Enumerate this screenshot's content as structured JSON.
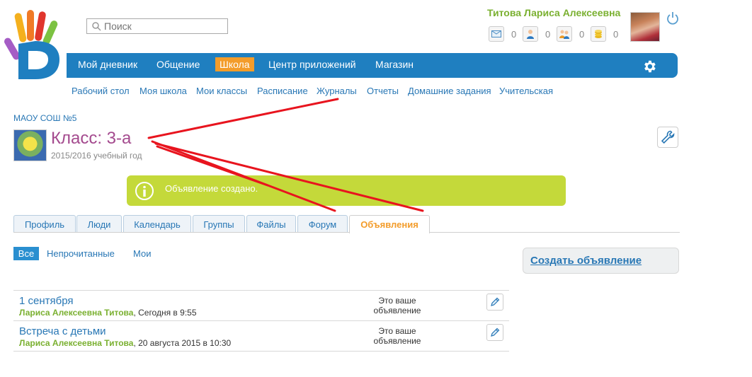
{
  "search": {
    "placeholder": "Поиск"
  },
  "user": {
    "name": "Титова Лариса Алексеевна",
    "counters": [
      {
        "icon": "mail-icon",
        "count": "0"
      },
      {
        "icon": "person-icon",
        "count": "0"
      },
      {
        "icon": "people-icon",
        "count": "0"
      },
      {
        "icon": "coins-icon",
        "count": "0"
      }
    ]
  },
  "nav": {
    "items": [
      "Мой дневник",
      "Общение",
      "Школа",
      "Центр приложений",
      "Магазин"
    ],
    "active": "Школа"
  },
  "subnav": {
    "items": [
      "Рабочий стол",
      "Моя школа",
      "Мои классы",
      "Расписание",
      "Журналы",
      "Отчеты",
      "Домашние задания",
      "Учительская"
    ]
  },
  "school": {
    "name": "МАОУ СОШ №5"
  },
  "class": {
    "title": "Класс: 3-а",
    "year": "2015/2016 учебный год"
  },
  "notification": {
    "text": "Объявление создано."
  },
  "tabs": {
    "items": [
      "Профиль",
      "Люди",
      "Календарь",
      "Группы",
      "Файлы",
      "Форум",
      "Объявления"
    ],
    "active": "Объявления"
  },
  "filters": {
    "items": [
      "Все",
      "Непрочитанные",
      "Мои"
    ],
    "active": "Все"
  },
  "create_button": {
    "label": "Создать объявление"
  },
  "announcements": [
    {
      "title": "1 сентября",
      "author": "Лариса Алексеевна Титова",
      "date": ", Сегодня в 9:55",
      "status_line1": "Это ваше",
      "status_line2": "объявление"
    },
    {
      "title": "Встреча с детьми",
      "author": "Лариса Алексеевна Титова",
      "date": ", 20 августа 2015 в 10:30",
      "status_line1": "Это ваше",
      "status_line2": "объявление"
    }
  ],
  "colors": {
    "nav_blue": "#1f7fc0",
    "active_orange": "#f39c2a",
    "link_blue": "#2877b5",
    "user_green": "#7ab030",
    "notification_green": "#c4d93a",
    "class_title_purple": "#a44a8e",
    "annotation_red": "#e8141e"
  }
}
